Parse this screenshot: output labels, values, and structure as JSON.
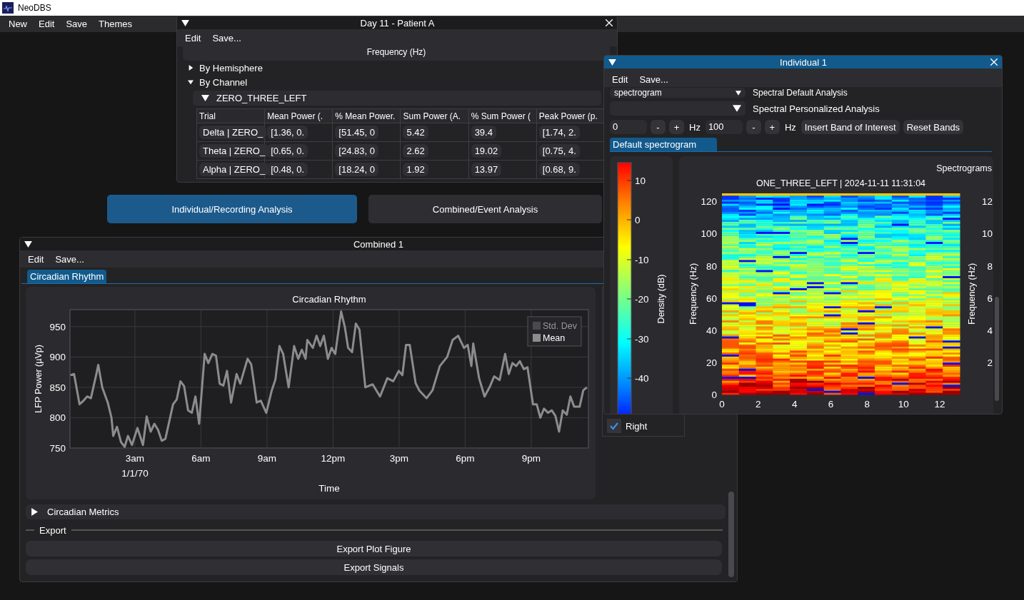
{
  "app": {
    "title": "NeoDBS",
    "menu": [
      "New",
      "Edit",
      "Save",
      "Themes"
    ]
  },
  "mode_tabs": [
    {
      "label": "Individual/Recording Analysis",
      "selected": true
    },
    {
      "label": "Combined/Event Analysis",
      "selected": false
    }
  ],
  "day_window": {
    "title": "Day 11 - Patient A",
    "menu": [
      "Edit",
      "Save..."
    ],
    "axis_label": "Frequency (Hz)",
    "sections": [
      {
        "label": "By Hemisphere",
        "expanded": false
      },
      {
        "label": "By Channel",
        "expanded": true
      }
    ],
    "channel": {
      "label": "ZERO_THREE_LEFT",
      "expanded": true
    },
    "table": {
      "columns": [
        "Trial",
        "Mean Power (.",
        "% Mean Power.",
        "Sum Power (A.",
        "% Sum Power (",
        "Peak Power (p."
      ],
      "rows": [
        [
          "Delta | ZERO_",
          "[1.36, 0.",
          "[51.45, 0",
          "5.42",
          "39.4",
          "[1.74, 2."
        ],
        [
          "Theta | ZERO_",
          "[0.65, 0.",
          "[24.83, 0",
          "2.62",
          "19.02",
          "[0.75, 4."
        ],
        [
          "Alpha | ZERO_",
          "[0.48, 0.",
          "[18.24, 0",
          "1.92",
          "13.97",
          "[0.68, 9."
        ]
      ]
    }
  },
  "combined_window": {
    "title": "Combined 1",
    "menu": [
      "Edit",
      "Save..."
    ],
    "tabs": [
      {
        "label": "Circadian Rhythm",
        "selected": true
      }
    ],
    "chart": {
      "date_label": "1/1/70",
      "legend": [
        {
          "label": "Std. Dev",
          "on": false
        }
      ],
      "chart_data": {
        "type": "line",
        "grid": true,
        "title": "Circadian Rhythm",
        "xlabel": "Time",
        "ylabel": "LFP Power (µVp)",
        "x": [
          "--01-01T00:04",
          "--01-01T00:14",
          "--01-01T00:29",
          "--01-01T00:40",
          "--01-01T00:50",
          "--01-01T01:00",
          "--01-01T01:15",
          "--01-01T01:20",
          "--01-01T01:31",
          "--01-01T01:46",
          "--01-01T01:56",
          "--01-01T02:01",
          "--01-01T02:11",
          "--01-01T02:22",
          "--01-01T02:32",
          "--01-01T02:41",
          "--01-01T02:52",
          "--01-01T03:07",
          "--01-01T03:22",
          "--01-01T03:32",
          "--01-01T03:43",
          "--01-01T03:53",
          "--01-01T04:03",
          "--01-01T04:13",
          "--01-01T04:23",
          "--01-01T04:44",
          "--01-01T04:54",
          "--01-01T05:04",
          "--01-01T05:14",
          "--01-01T05:25",
          "--01-01T05:35",
          "--01-01T05:45",
          "--01-01T05:55",
          "--01-01T06:10",
          "--01-01T06:20",
          "--01-01T06:31",
          "--01-01T06:41",
          "--01-01T06:51",
          "--01-01T07:01",
          "--01-01T07:11",
          "--01-01T07:22",
          "--01-01T07:37",
          "--01-01T07:47",
          "--01-01T08:07",
          "--01-01T08:17",
          "--01-01T08:32",
          "--01-01T08:43",
          "--01-01T08:58",
          "--01-01T09:13",
          "--01-01T09:23",
          "--01-01T09:34",
          "--01-01T09:44",
          "--01-01T09:59",
          "--01-01T10:14",
          "--01-01T10:25",
          "--01-01T10:35",
          "--01-01T10:45",
          "--01-01T10:50",
          "--01-01T11:05",
          "--01-01T11:15",
          "--01-01T11:25",
          "--01-01T11:35",
          "--01-01T11:46",
          "--01-01T11:56",
          "--01-01T12:06",
          "--01-01T12:22",
          "--01-01T12:32",
          "--01-01T12:41",
          "--01-01T12:52",
          "--01-01T13:02",
          "--01-01T13:12",
          "--01-01T13:28",
          "--01-01T13:48",
          "--01-01T14:08",
          "--01-01T14:28",
          "--01-01T14:44",
          "--01-01T14:59",
          "--01-01T15:09",
          "--01-01T15:19",
          "--01-01T15:29",
          "--01-01T15:45",
          "--01-01T15:55",
          "--01-01T16:15",
          "--01-01T16:31",
          "--01-01T16:51",
          "--01-01T17:11",
          "--01-01T17:26",
          "--01-01T17:41",
          "--01-01T17:57",
          "--01-01T18:07",
          "--01-01T18:17",
          "--01-01T18:22",
          "--01-01T18:38",
          "--01-01T18:53",
          "--01-01T19:08",
          "--01-01T19:19",
          "--01-01T19:34",
          "--01-01T19:49",
          "--01-01T19:59",
          "--01-01T20:09",
          "--01-01T20:19",
          "--01-01T20:29",
          "--01-01T20:40",
          "--01-01T20:50",
          "--01-01T21:05",
          "--01-01T21:15",
          "--01-01T21:25",
          "--01-01T21:35",
          "--01-01T21:46",
          "--01-01T21:56",
          "--01-01T22:06",
          "--01-01T22:16",
          "--01-01T22:26",
          "--01-01T22:37",
          "--01-01T22:47",
          "--01-01T22:57",
          "--01-01T23:12",
          "--01-01T23:22",
          "--01-01T23:32"
        ],
        "series": [
          {
            "name": "Mean",
            "color": "#8c8c8c",
            "values": [
              870,
              872,
              822,
              828,
              835,
              832,
              872,
              887,
              850,
              825,
              800,
              770,
              785,
              760,
              752,
              770,
              755,
              783,
              755,
              802,
              777,
              790,
              780,
              762,
              765,
              822,
              830,
              860,
              852,
              812,
              808,
              835,
              790,
              905,
              890,
              905,
              902,
              856,
              853,
              877,
              825,
              872,
              856,
              897,
              888,
              825,
              828,
              808,
              845,
              863,
              918,
              905,
              850,
              918,
              897,
              912,
              897,
              928,
              915,
              935,
              918,
              935,
              897,
              915,
              905,
              975,
              950,
              915,
              908,
              955,
              945,
              850,
              855,
              835,
              865,
              860,
              877,
              870,
              920,
              920,
              857,
              845,
              832,
              845,
              885,
              900,
              928,
              935,
              915,
              920,
              885,
              922,
              865,
              835,
              852,
              868,
              862,
              905,
              872,
              890,
              885,
              893,
              880,
              883,
              822,
              822,
              800,
              815,
              808,
              812,
              803,
              777,
              812,
              805,
              835,
              818,
              818,
              845,
              850
            ]
          }
        ],
        "xlim": [
          "--01-01T00:03",
          "--01-01T23:36"
        ],
        "ylim": [
          750,
          978
        ],
        "xticks": [
          {
            "value": "--01-01T03:00",
            "label": "3am"
          },
          {
            "value": "--01-01T06:00",
            "label": "6am"
          },
          {
            "value": "--01-01T09:00",
            "label": "9am"
          },
          {
            "value": "--01-01T12:00",
            "label": "12pm"
          },
          {
            "value": "--01-01T15:00",
            "label": "3pm"
          },
          {
            "value": "--01-01T18:00",
            "label": "6pm"
          },
          {
            "value": "--01-01T21:00",
            "label": "9pm"
          }
        ],
        "yticks": [
          750,
          800,
          850,
          900,
          950
        ]
      }
    },
    "side_checkbox": {
      "label": "Right",
      "checked": true
    },
    "sections": [
      {
        "label": "Circadian Metrics",
        "expanded": false
      }
    ],
    "export": {
      "label": "Export",
      "buttons": [
        "Export Plot Figure",
        "Export Signals"
      ]
    }
  },
  "individual_window": {
    "title": "Individual 1",
    "menu": [
      "Edit",
      "Save..."
    ],
    "default_analysis": {
      "value": "spectrogram",
      "label": "Spectral Default Analysis"
    },
    "personalized_analysis": {
      "label": "Spectral Personalized Analysis"
    },
    "band_controls": [
      {
        "kind": "input",
        "text": "0"
      },
      {
        "kind": "button",
        "text": "-"
      },
      {
        "kind": "button",
        "text": "+"
      },
      {
        "kind": "unit",
        "text": "Hz"
      },
      {
        "kind": "input",
        "text": "100"
      },
      {
        "kind": "button",
        "text": "-"
      },
      {
        "kind": "button",
        "text": "+"
      },
      {
        "kind": "unit",
        "text": "Hz"
      },
      {
        "kind": "button",
        "text": "Insert Band of Interest"
      },
      {
        "kind": "button",
        "text": "Reset Bands"
      }
    ],
    "tabs": [
      {
        "label": "Default spectrogram",
        "selected": true
      }
    ],
    "colorbar": {
      "label": "Density (dB)",
      "ticks": [
        "10",
        "0",
        "-10",
        "-20",
        "-30",
        "-40"
      ]
    },
    "spectrogram": {
      "panel_title": "Spectrograms",
      "title": "ONE_THREE_LEFT | 2024-11-11 11:31:04",
      "ylabel": "Frequency (Hz)",
      "yticks": [
        "120",
        "100",
        "80",
        "60",
        "40",
        "20",
        "0"
      ],
      "xticks": [
        "0",
        "2",
        "4",
        "6",
        "8",
        "10",
        "12"
      ],
      "right_ylabel": "Frequency (Hz)",
      "right_yticks": [
        "12",
        "10",
        "8",
        "6",
        "4",
        "2"
      ]
    }
  }
}
